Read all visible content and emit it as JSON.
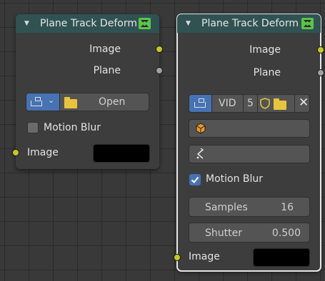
{
  "colors": {
    "canvas_bg": "#393939",
    "node_bg": "#3d3d3d",
    "header_bg": "#305252",
    "socket_image": "#c7c729",
    "socket_plane": "#a1a1a1",
    "accent": "#4772b3",
    "folder": "#e8c33d",
    "object_icon": "#e89b2c"
  },
  "nodes": [
    {
      "title": "Plane Track Deform",
      "selected": false,
      "outputs": [
        "Image",
        "Plane"
      ],
      "clip_selector": {
        "open_label": "Open"
      },
      "motion_blur": {
        "label": "Motion Blur",
        "checked": false
      },
      "inputs": [
        {
          "label": "Image",
          "color": "#000000"
        }
      ]
    },
    {
      "title": "Plane Track Deform",
      "selected": true,
      "outputs": [
        "Image",
        "Plane"
      ],
      "clip_selector": {
        "clip_name": "VID",
        "user_count": "5"
      },
      "object_field": {
        "value": ""
      },
      "track_field": {
        "value": ""
      },
      "motion_blur": {
        "label": "Motion Blur",
        "checked": true
      },
      "samples": {
        "label": "Samples",
        "value": "16"
      },
      "shutter": {
        "label": "Shutter",
        "value": "0.500"
      },
      "inputs": [
        {
          "label": "Image",
          "color": "#000000"
        }
      ]
    }
  ]
}
